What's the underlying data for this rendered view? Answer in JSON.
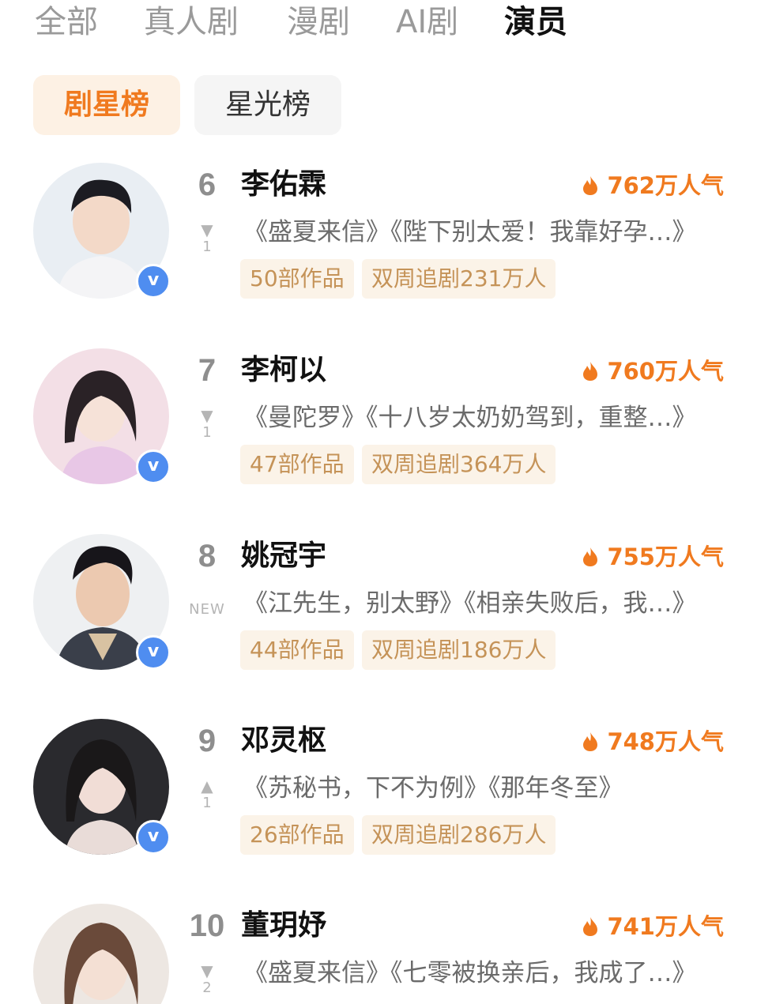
{
  "top_tabs": [
    "全部",
    "真人剧",
    "漫剧",
    "AI剧",
    "演员"
  ],
  "sub_tabs": [
    "剧星榜",
    "星光榜"
  ],
  "verified_mark": "v",
  "actors": [
    {
      "rank": "6",
      "change_dir": "down",
      "change_text": "1",
      "name": "李佑霖",
      "popularity": "762万人气",
      "works": "《盛夏来信》《陛下别太爱！我靠好孕…》",
      "count": "50部作品",
      "followers": "双周追剧231万人"
    },
    {
      "rank": "7",
      "change_dir": "down",
      "change_text": "1",
      "name": "李柯以",
      "popularity": "760万人气",
      "works": "《曼陀罗》《十八岁太奶奶驾到，重整…》",
      "count": "47部作品",
      "followers": "双周追剧364万人"
    },
    {
      "rank": "8",
      "change_dir": "new",
      "change_text": "NEW",
      "name": "姚冠宇",
      "popularity": "755万人气",
      "works": "《江先生，别太野》《相亲失败后，我…》",
      "count": "44部作品",
      "followers": "双周追剧186万人"
    },
    {
      "rank": "9",
      "change_dir": "up",
      "change_text": "1",
      "name": "邓灵枢",
      "popularity": "748万人气",
      "works": "《苏秘书，下不为例》《那年冬至》",
      "count": "26部作品",
      "followers": "双周追剧286万人"
    },
    {
      "rank": "10",
      "change_dir": "down",
      "change_text": "2",
      "name": "董玥妤",
      "popularity": "741万人气",
      "works": "《盛夏来信》《七零被换亲后，我成了…》",
      "count": "",
      "followers": ""
    }
  ],
  "icons": {
    "popularity": "flame-icon",
    "rank_down": "triangle-down-icon",
    "rank_up": "triangle-up-icon",
    "verified": "verified-badge-icon"
  },
  "colors": {
    "accent": "#f07a1f",
    "tag_bg": "#fbf3e8",
    "tag_text": "#c59358",
    "verified": "#4f8df0"
  }
}
